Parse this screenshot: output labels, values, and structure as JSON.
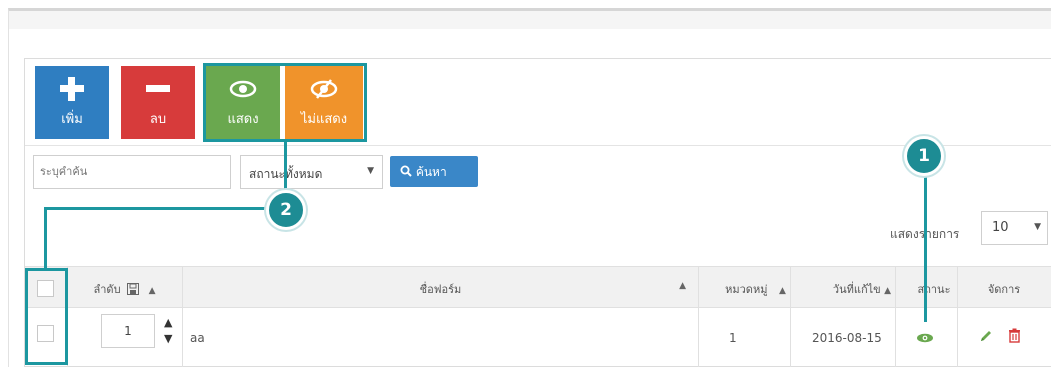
{
  "toolbar": {
    "add_label": "เพิ่ม",
    "delete_label": "ลบ",
    "show_label": "แสดง",
    "hide_label": "ไม่แสดง"
  },
  "filter": {
    "search_placeholder": "ระบุคำค้น",
    "status_value": "สถานะทั้งหมด",
    "search_button": "ค้นหา"
  },
  "badges": {
    "one": "1",
    "two": "2"
  },
  "per_page": {
    "label": "แสดงรายการ",
    "value": "10"
  },
  "table": {
    "headers": {
      "order": "ลำดับ",
      "name": "ชื่อฟอร์ม",
      "category": "หมวดหมู่",
      "updated": "วันที่แก้ไข",
      "status": "สถานะ",
      "manage": "จัดการ"
    },
    "rows": [
      {
        "order": "1",
        "name": "aa",
        "category": "1",
        "updated": "2016-08-15"
      }
    ]
  },
  "colors": {
    "add": "#2f7ec1",
    "delete": "#d73b3b",
    "show": "#6aa84f",
    "hide": "#f0932b",
    "highlight": "#1c97a0"
  },
  "icons": [
    "plus-icon",
    "minus-icon",
    "eye-icon",
    "eye-slash-icon",
    "search-icon",
    "save-icon",
    "sort-up-icon",
    "pencil-icon",
    "trash-icon"
  ]
}
